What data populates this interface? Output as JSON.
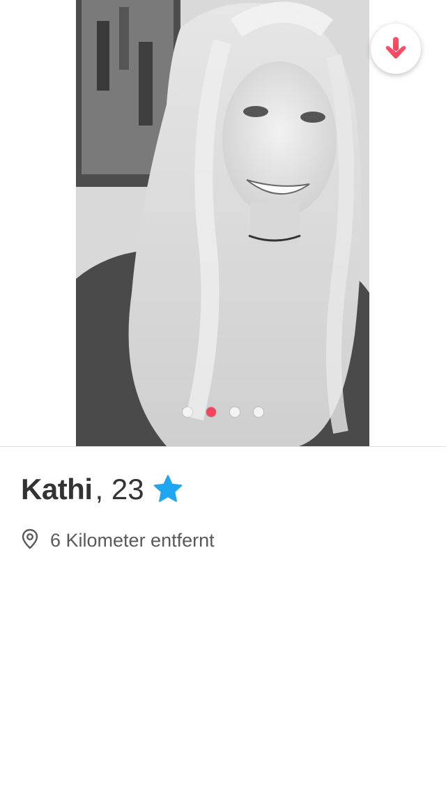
{
  "profile": {
    "name": "Kathi",
    "age": ", 23",
    "distance": "6 Kilometer entfernt",
    "verified": true
  },
  "photos": {
    "count": 4,
    "active_index": 1
  },
  "icons": {
    "collapse": "arrow-down-icon",
    "location": "location-pin-icon",
    "verified": "star-icon"
  },
  "colors": {
    "accent": "#f0445f",
    "verified": "#1fa6f0",
    "text": "#333333",
    "secondary_text": "#595959"
  }
}
